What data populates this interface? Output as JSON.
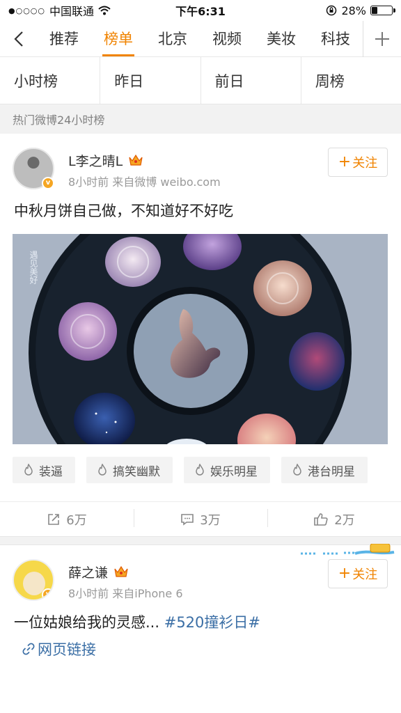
{
  "status_bar": {
    "signal": "●○○○○",
    "carrier": "中国联通",
    "wifi_icon": "wifi-icon",
    "time": "下午6:31",
    "lock_icon": "rotation-lock-icon",
    "battery_percent": "28%",
    "battery_level": 0.28
  },
  "nav": {
    "back_icon": "chevron-left-icon",
    "tabs": [
      {
        "label": "推荐",
        "active": false
      },
      {
        "label": "榜单",
        "active": true
      },
      {
        "label": "北京",
        "active": false
      },
      {
        "label": "视频",
        "active": false
      },
      {
        "label": "美妆",
        "active": false
      },
      {
        "label": "科技",
        "active": false
      }
    ],
    "plus_icon": "plus-icon",
    "accent_color": "#f08300"
  },
  "sub_tabs": [
    "小时榜",
    "昨日",
    "前日",
    "周榜"
  ],
  "section_header": "热门微博24小时榜",
  "posts": [
    {
      "username": "L李之晴L",
      "badge_icon": "crown-icon",
      "verified_icon": "verified-v-icon",
      "meta": "8小时前  来自微博 weibo.com",
      "follow_label": "关注",
      "text": "中秋月饼自己做，不知道好不好吃",
      "image_alt": "mooncakes-in-round-tray-photo",
      "tags": [
        "装逼",
        "搞笑幽默",
        "娱乐明星",
        "港台明星"
      ],
      "actions": {
        "repost": "6万",
        "comment": "3万",
        "like": "2万"
      }
    },
    {
      "username": "薛之谦",
      "badge_icon": "crown-icon",
      "verified_icon": "verified-v-icon",
      "meta": "8小时前  来自iPhone 6",
      "follow_label": "关注",
      "text": "一位姑娘给我的灵感...",
      "hashtag": "#520撞衫日#",
      "link_label": "网页链接"
    }
  ]
}
